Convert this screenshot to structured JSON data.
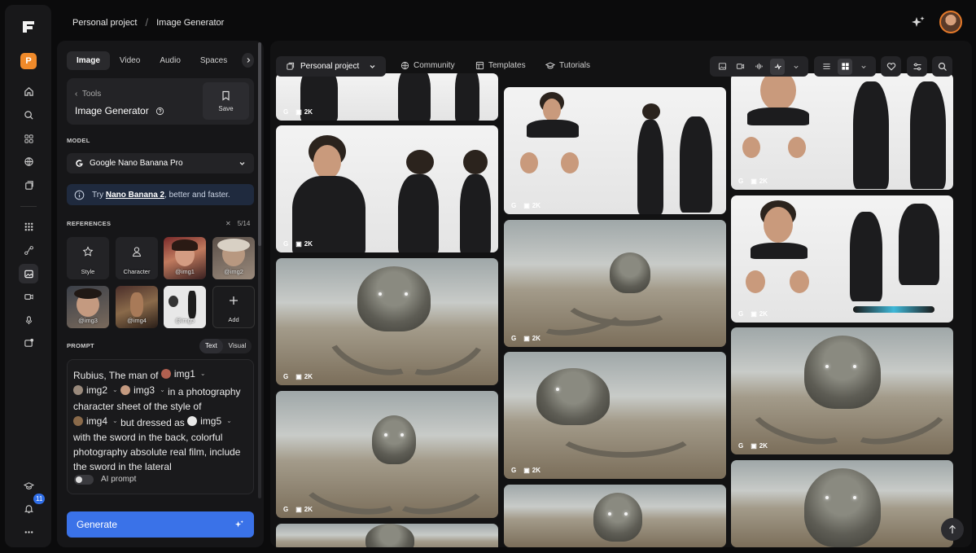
{
  "breadcrumb": {
    "project": "Personal project",
    "page": "Image Generator"
  },
  "rail": {
    "workspace_letter": "P",
    "notification_count": "11"
  },
  "panel": {
    "tabs": [
      "Image",
      "Video",
      "Audio",
      "Spaces"
    ],
    "tools_link": "Tools",
    "tool_title": "Image Generator",
    "save_label": "Save",
    "model_section": "MODEL",
    "model_value": "Google Nano Banana Pro",
    "tip_prefix": "Try ",
    "tip_link": "Nano Banana 2",
    "tip_suffix": ", better and faster.",
    "references_section": "REFERENCES",
    "references_count": "5/14",
    "references": [
      {
        "label": "Style"
      },
      {
        "label": "Character"
      },
      {
        "label": "@img1"
      },
      {
        "label": "@img2"
      },
      {
        "label": "@img3"
      },
      {
        "label": "@img4"
      },
      {
        "label": "@img5"
      },
      {
        "label": "Add"
      }
    ],
    "prompt_section": "PROMPT",
    "prompt_mode_text": "Text",
    "prompt_mode_visual": "Visual",
    "prompt": {
      "part1": "Rubius, The man of",
      "chip1": "img1",
      "chip2": "img2",
      "chip3": "img3",
      "part2": "in a photography character sheet of the style of",
      "chip4": "img4",
      "part3": "but dressed as",
      "chip5": "img5",
      "part4": "with the sword in the back, colorful photography absolute real film, include the sword in the lateral"
    },
    "ai_prompt_label": "AI prompt",
    "generate_label": "Generate"
  },
  "toolbar": {
    "project_label": "Personal project",
    "community_label": "Community",
    "templates_label": "Templates",
    "tutorials_label": "Tutorials"
  },
  "gallery": {
    "quality_label": "2K",
    "card_count": 14
  }
}
